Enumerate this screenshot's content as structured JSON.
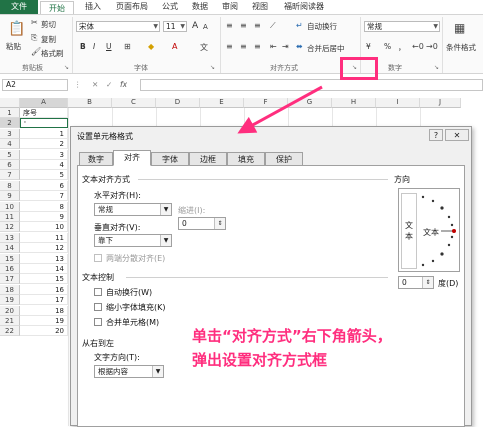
{
  "ribbon_tabs": [
    "文件",
    "开始",
    "插入",
    "页面布局",
    "公式",
    "数据",
    "审阅",
    "视图",
    "福昕阅读器"
  ],
  "clipboard": {
    "paste": "粘贴",
    "cut": "剪切",
    "copy": "复制",
    "format_painter": "格式刷",
    "group": "剪贴板"
  },
  "font": {
    "name": "宋体",
    "size": "11",
    "bold": "B",
    "italic": "I",
    "underline": "U",
    "grow": "A",
    "shrink": "A",
    "group": "字体"
  },
  "alignment": {
    "wrap": "自动换行",
    "merge": "合并后居中",
    "group": "对齐方式"
  },
  "number": {
    "format": "常规",
    "currency": "¥",
    "percent": "%",
    "comma": "，",
    "group": "数字"
  },
  "styles": {
    "conditional": "条件格式"
  },
  "formula_bar": {
    "name_box": "A2",
    "cancel": "✕",
    "enter": "✓",
    "fx": "fx"
  },
  "grid": {
    "columns": [
      "A",
      "B",
      "C",
      "D",
      "E",
      "F",
      "G",
      "H",
      "I",
      "J"
    ],
    "rows": [
      "1",
      "2",
      "3",
      "4",
      "5",
      "6",
      "7",
      "8",
      "9",
      "10",
      "11",
      "12",
      "13",
      "14",
      "15",
      "16",
      "17",
      "18",
      "19",
      "20",
      "21",
      "22"
    ],
    "a1": "序号",
    "a2": "'",
    "values": [
      "1",
      "2",
      "3",
      "4",
      "5",
      "6",
      "7",
      "8",
      "9",
      "10",
      "11",
      "12",
      "13",
      "14",
      "15",
      "16",
      "17",
      "18",
      "19",
      "20"
    ]
  },
  "dialog": {
    "title": "设置单元格格式",
    "help": "?",
    "close": "✕",
    "tabs": [
      "数字",
      "对齐",
      "字体",
      "边框",
      "填充",
      "保护"
    ],
    "text_align_section": "文本对齐方式",
    "h_align_label": "水平对齐(H):",
    "h_align_value": "常规",
    "indent_label": "缩进(I):",
    "indent_value": "0",
    "v_align_label": "垂直对齐(V):",
    "v_align_value": "靠下",
    "distributed": "两端分散对齐(E)",
    "text_control_section": "文本控制",
    "wrap_text": "自动换行(W)",
    "shrink_fit": "缩小字体填充(K)",
    "merge_cells": "合并单元格(M)",
    "rtl_section": "从右到左",
    "direction_label": "文字方向(T):",
    "direction_value": "根据内容",
    "orientation_section": "方向",
    "orient_vertical": "文本",
    "orient_text": "文本",
    "degrees_value": "0",
    "degrees_label": "度(D)"
  },
  "annotation": {
    "line1": "单击“对齐方式”右下角箭头，",
    "line2": "弹出设置对齐方式框",
    "color": "#ff2e7e"
  }
}
